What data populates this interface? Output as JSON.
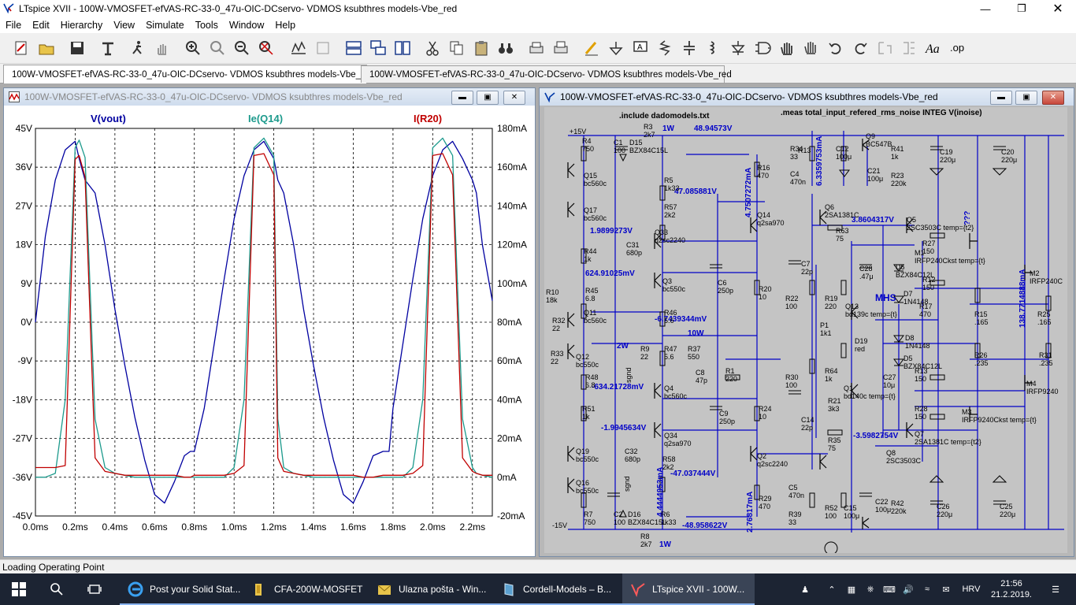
{
  "app": {
    "title": "LTspice XVII - 100W-VMOSFET-efVAS-RC-33-0_47u-OIC-DCservo- VDMOS ksubthres models-Vbe_red"
  },
  "menu": [
    "File",
    "Edit",
    "Hierarchy",
    "View",
    "Simulate",
    "Tools",
    "Window",
    "Help"
  ],
  "tabs": [
    {
      "label": "100W-VMOSFET-efVAS-RC-33-0_47u-OIC-DCservo- VDMOS ksubthres models-Vbe_red",
      "kind": "schematic"
    },
    {
      "label": "100W-VMOSFET-efVAS-RC-33-0_47u-OIC-DCservo- VDMOS ksubthres models-Vbe_red",
      "kind": "waveform"
    }
  ],
  "waveform_window": {
    "title": "100W-VMOSFET-efVAS-RC-33-0_47u-OIC-DCservo- VDMOS ksubthres models-Vbe_red",
    "buttons": [
      "minimize",
      "restore",
      "close"
    ]
  },
  "schematic_window": {
    "title": "100W-VMOSFET-efVAS-RC-33-0_47u-OIC-DCservo- VDMOS ksubthres models-Vbe_red",
    "directives": [
      ".include dadomodels.txt",
      ".meas total_input_refered_rms_noise INTEG V(inoise)"
    ],
    "node_voltages": [
      "48.94573V",
      "47.085881V",
      "1.9899273V",
      "624.91025mV",
      "-6.7439344mV",
      "-634.21728mV",
      "-1.9945634V",
      "-47.037444V",
      "-48.958622V",
      "3.8604317V",
      "-3.5982754V"
    ],
    "current_labels": [
      "6.3359753mA",
      "4.7507272mA",
      "4.4444953mA",
      "2.76817mA",
      "138.7714888mA"
    ],
    "power_labels": [
      "1W",
      "10W",
      "2W",
      "1W"
    ],
    "text_labels": [
      "MHS",
      "???",
      "+15V",
      "-15V",
      "sgnd"
    ],
    "components": [
      {
        "ref": "R3",
        "value": "2k7"
      },
      {
        "ref": "R4",
        "value": "750"
      },
      {
        "ref": "C1",
        "value": "100"
      },
      {
        "ref": "D15",
        "value": "BZX84C15L"
      },
      {
        "ref": "Q15",
        "value": "bc560c"
      },
      {
        "ref": "R5",
        "value": "1k33"
      },
      {
        "ref": "Q17",
        "value": "bc560c"
      },
      {
        "ref": "R57",
        "value": "2k2"
      },
      {
        "ref": "Q33",
        "value": "q2sc2240"
      },
      {
        "ref": "C31",
        "value": "680p"
      },
      {
        "ref": "R44",
        "value": "1k"
      },
      {
        "ref": "Q3",
        "value": "bc550c"
      },
      {
        "ref": "R45",
        "value": "6.8"
      },
      {
        "ref": "R46",
        "value": "5.6"
      },
      {
        "ref": "Q11",
        "value": "bc560c"
      },
      {
        "ref": "R32",
        "value": "22"
      },
      {
        "ref": "R9",
        "value": "22"
      },
      {
        "ref": "R47",
        "value": "5.6"
      },
      {
        "ref": "R37",
        "value": "550"
      },
      {
        "ref": "R33",
        "value": "22"
      },
      {
        "ref": "Q12",
        "value": "bc550c"
      },
      {
        "ref": "R48",
        "value": "6.8"
      },
      {
        "ref": "Q4",
        "value": "bc560c"
      },
      {
        "ref": "R51",
        "value": "1k"
      },
      {
        "ref": "Q34",
        "value": "q2sa970"
      },
      {
        "ref": "C32",
        "value": "680p"
      },
      {
        "ref": "Q19",
        "value": "bc550c"
      },
      {
        "ref": "R58",
        "value": "2k2"
      },
      {
        "ref": "Q16",
        "value": "bc550c"
      },
      {
        "ref": "D16",
        "value": "BZX84C15L"
      },
      {
        "ref": "R6",
        "value": "1k33"
      },
      {
        "ref": "C2",
        "value": "100"
      },
      {
        "ref": "R7",
        "value": "750"
      },
      {
        "ref": "R8",
        "value": "2k7"
      },
      {
        "ref": "R16",
        "value": "470"
      },
      {
        "ref": "Q14",
        "value": "q2sa970"
      },
      {
        "ref": "C6",
        "value": "250p"
      },
      {
        "ref": "C8",
        "value": "47p"
      },
      {
        "ref": "R1",
        "value": "220"
      },
      {
        "ref": "C9",
        "value": "250p"
      },
      {
        "ref": "R20",
        "value": "10"
      },
      {
        "ref": "R24",
        "value": "10"
      },
      {
        "ref": "Q2",
        "value": "q2sc2240"
      },
      {
        "ref": "R29",
        "value": "470"
      },
      {
        "ref": "R34",
        "value": "33"
      },
      {
        "ref": "C4",
        "value": "470n"
      },
      {
        "ref": "R13",
        "value": ""
      },
      {
        "ref": "C12",
        "value": "100μ"
      },
      {
        "ref": "Q9",
        "value": "BC547B"
      },
      {
        "ref": "R41",
        "value": "1k"
      },
      {
        "ref": "C21",
        "value": "100μ"
      },
      {
        "ref": "R23",
        "value": "220k"
      },
      {
        "ref": "C19",
        "value": "220μ"
      },
      {
        "ref": "C20",
        "value": "220μ"
      },
      {
        "ref": "Q6",
        "value": "2SA1381C"
      },
      {
        "ref": "R63",
        "value": "75"
      },
      {
        "ref": "Q5",
        "value": "2SC3503C temp={t2}"
      },
      {
        "ref": "M1",
        "value": "IRFP240Ckst temp={t}"
      },
      {
        "ref": "R27",
        "value": "150"
      },
      {
        "ref": "D6",
        "value": "BZX84C12L"
      },
      {
        "ref": "R12",
        "value": "150"
      },
      {
        "ref": "M2",
        "value": "IRFP240C"
      },
      {
        "ref": "C7",
        "value": "22p"
      },
      {
        "ref": "C28",
        "value": ".47μ"
      },
      {
        "ref": "R22",
        "value": "100"
      },
      {
        "ref": "R19",
        "value": "220"
      },
      {
        "ref": "Q13",
        "value": "bd139c temp={t}"
      },
      {
        "ref": "D7",
        "value": "1N4148"
      },
      {
        "ref": "R17",
        "value": "470"
      },
      {
        "ref": "R15",
        "value": ".165"
      },
      {
        "ref": "R25",
        "value": ".165"
      },
      {
        "ref": "P1",
        "value": "1k1"
      },
      {
        "ref": "D19",
        "value": "red"
      },
      {
        "ref": "D8",
        "value": "1N4148"
      },
      {
        "ref": "D5",
        "value": "BZX84C12L"
      },
      {
        "ref": "R26",
        "value": ".235"
      },
      {
        "ref": "R31",
        "value": ".235"
      },
      {
        "ref": "R30",
        "value": "100"
      },
      {
        "ref": "R64",
        "value": "1k"
      },
      {
        "ref": "Q1",
        "value": "bd140c temp={t}"
      },
      {
        "ref": "C27",
        "value": "10μ"
      },
      {
        "ref": "R13b",
        "value": "150"
      },
      {
        "ref": "M4",
        "value": "IRFP9240"
      },
      {
        "ref": "C14",
        "value": "22p"
      },
      {
        "ref": "R21",
        "value": "3k3"
      },
      {
        "ref": "R28",
        "value": "150"
      },
      {
        "ref": "M3",
        "value": "IRFP9240Ckst temp={t}"
      },
      {
        "ref": "R35",
        "value": "75"
      },
      {
        "ref": "Q7",
        "value": "2SA1381C temp={t2}"
      },
      {
        "ref": "Q8",
        "value": "2SC3503C"
      },
      {
        "ref": "C5",
        "value": "470n"
      },
      {
        "ref": "R39",
        "value": "33"
      },
      {
        "ref": "R52",
        "value": "100"
      },
      {
        "ref": "C15",
        "value": "100μ"
      },
      {
        "ref": "C22",
        "value": "100μ"
      },
      {
        "ref": "R42",
        "value": "220k"
      },
      {
        "ref": "C26",
        "value": "220μ"
      },
      {
        "ref": "C25",
        "value": "220μ"
      },
      {
        "ref": "R10",
        "value": "18k"
      }
    ]
  },
  "chart_data": {
    "type": "line",
    "x": [
      0,
      0.05,
      0.1,
      0.15,
      0.2,
      0.22,
      0.25,
      0.3,
      0.35,
      0.4,
      0.45,
      0.5,
      0.55,
      0.6,
      0.65,
      0.7,
      0.75,
      0.78,
      0.8,
      0.85,
      0.9,
      0.95,
      1.0,
      1.05,
      1.1,
      1.15,
      1.2,
      1.22,
      1.25,
      1.3,
      1.35,
      1.4,
      1.45,
      1.5,
      1.55,
      1.6,
      1.65,
      1.7,
      1.75,
      1.78,
      1.8,
      1.85,
      1.9,
      1.95,
      2.0,
      2.05,
      2.1,
      2.15,
      2.2,
      2.22,
      2.25,
      2.3
    ],
    "xlabel": "",
    "xunit": "ms",
    "x_ticks": [
      "0.0ms",
      "0.2ms",
      "0.4ms",
      "0.6ms",
      "0.8ms",
      "1.0ms",
      "1.2ms",
      "1.4ms",
      "1.6ms",
      "1.8ms",
      "2.0ms",
      "2.2ms"
    ],
    "xlim": [
      0,
      2.3
    ],
    "y_left_ticks": [
      "45V",
      "36V",
      "27V",
      "18V",
      "9V",
      "0V",
      "-9V",
      "-18V",
      "-27V",
      "-36V",
      "-45V"
    ],
    "ylim_left": [
      -45,
      45
    ],
    "y_right_ticks": [
      "180mA",
      "160mA",
      "140mA",
      "120mA",
      "100mA",
      "80mA",
      "60mA",
      "40mA",
      "20mA",
      "0mA",
      "-20mA"
    ],
    "ylim_right": [
      -20,
      180
    ],
    "grid": true,
    "legend_position": "top",
    "series": [
      {
        "name": "V(vout)",
        "axis": "left",
        "color": "#0000a0",
        "values": [
          0,
          20,
          33,
          40,
          42,
          38,
          33,
          30,
          18,
          3,
          -10,
          -22,
          -32,
          -40,
          -42,
          -37,
          -31,
          -30,
          -30,
          -20,
          -5,
          10,
          24,
          34,
          40,
          42,
          38,
          33,
          30,
          18,
          3,
          -10,
          -22,
          -32,
          -40,
          -42,
          -37,
          -31,
          -30,
          -30,
          -20,
          -5,
          10,
          24,
          34,
          40,
          42,
          38,
          33,
          30,
          18,
          5
        ]
      },
      {
        "name": "Ie(Q14)",
        "axis": "right",
        "color": "#1c9a8c",
        "values": [
          0,
          0,
          2,
          40,
          170,
          174,
          165,
          30,
          5,
          2,
          1,
          0,
          0,
          0,
          0,
          0,
          0,
          0,
          0,
          0,
          0,
          0,
          5,
          40,
          170,
          175,
          166,
          30,
          5,
          2,
          1,
          0,
          0,
          0,
          0,
          0,
          0,
          0,
          0,
          0,
          0,
          0,
          5,
          40,
          170,
          175,
          166,
          30,
          5,
          2,
          1,
          0
        ]
      },
      {
        "name": "I(R20)",
        "axis": "right",
        "color": "#c00000",
        "values": [
          5,
          5,
          5,
          6,
          164,
          166,
          155,
          10,
          3,
          2,
          1,
          1,
          1,
          1,
          1,
          1,
          0,
          0,
          1,
          1,
          1,
          1,
          2,
          6,
          166,
          167,
          156,
          10,
          3,
          2,
          1,
          1,
          1,
          1,
          1,
          1,
          0,
          0,
          1,
          1,
          1,
          1,
          2,
          6,
          166,
          167,
          156,
          10,
          3,
          2,
          1,
          1
        ]
      }
    ]
  },
  "status": {
    "text": "Loading Operating Point"
  },
  "taskbar": {
    "items": [
      {
        "label": "Post your Solid Stat...",
        "icon": "edge-icon"
      },
      {
        "label": "CFA-200W-MOSFET",
        "icon": "folder-icon"
      },
      {
        "label": "Ulazna pošta - Win...",
        "icon": "mail-icon"
      },
      {
        "label": "Cordell-Models – B...",
        "icon": "book-icon"
      },
      {
        "label": "LTspice XVII - 100W...",
        "icon": "ltspice-icon"
      }
    ],
    "language": "HRV",
    "time": "21:56",
    "date": "21.2.2019."
  }
}
